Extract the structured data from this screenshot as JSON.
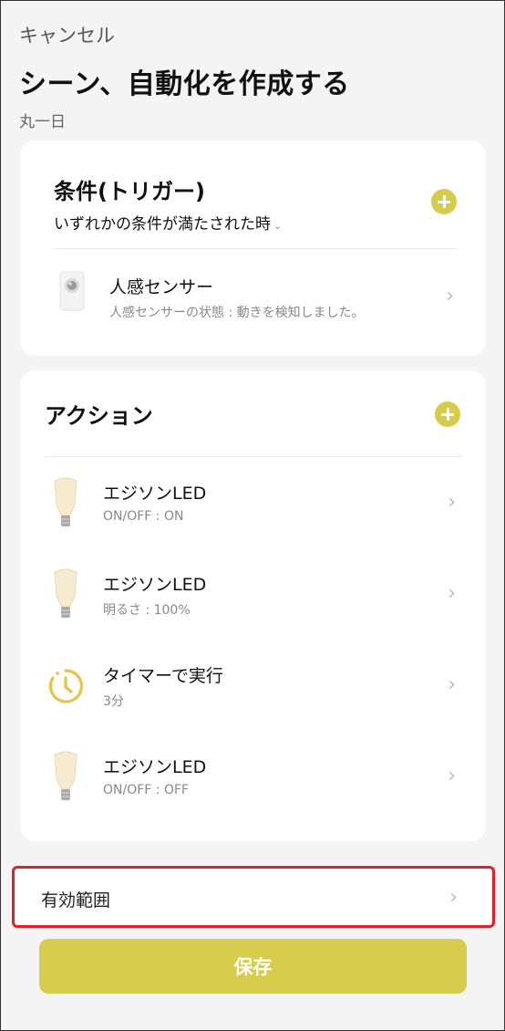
{
  "header": {
    "cancel_label": "キャンセル",
    "title": "シーン、自動化を作成する",
    "subtitle": "丸一日"
  },
  "condition_card": {
    "title": "条件(トリガー)",
    "mode": "いずれかの条件が満たされた時",
    "items": [
      {
        "name": "人感センサー",
        "detail": "人感センサーの状態 : 動きを検知しました。",
        "icon": "motion-sensor-icon"
      }
    ]
  },
  "action_card": {
    "title": "アクション",
    "items": [
      {
        "name": "エジソンLED",
        "detail": "ON/OFF : ON",
        "icon": "edison-bulb-icon"
      },
      {
        "name": "エジソンLED",
        "detail": "明るさ : 100%",
        "icon": "edison-bulb-icon"
      },
      {
        "name": "タイマーで実行",
        "detail": "3分",
        "icon": "timer-icon"
      },
      {
        "name": "エジソンLED",
        "detail": "ON/OFF : OFF",
        "icon": "edison-bulb-icon"
      }
    ]
  },
  "scope": {
    "label": "有効範囲",
    "highlight_color": "#e21f26"
  },
  "footer": {
    "save_label": "保存"
  },
  "colors": {
    "accent": "#d6cc4a",
    "background": "#f4f4f4",
    "card": "#ffffff"
  }
}
